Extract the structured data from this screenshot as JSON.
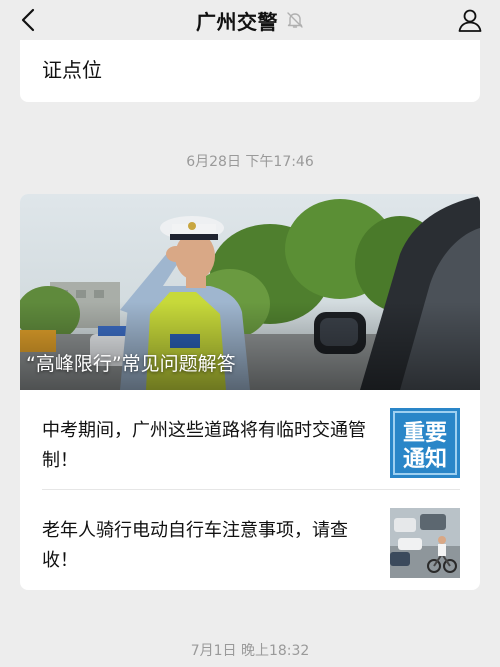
{
  "navbar": {
    "title": "广州交警",
    "back_icon": "back-chevron-icon",
    "mute_icon": "bell-muted-icon",
    "profile_icon": "person-icon"
  },
  "previous_card": {
    "text": "证点位"
  },
  "messages": [
    {
      "timestamp": "6月28日 下午17:46",
      "cover": {
        "title": "“高峰限行”常见问题解答"
      },
      "items": [
        {
          "title": "中考期间，广州这些道路将有临时交通管制！",
          "thumb_text_line1": "重要",
          "thumb_text_line2": "通知"
        },
        {
          "title": "老年人骑行电动自行车注意事项，请查收！"
        }
      ]
    },
    {
      "timestamp": "7月1日 晚上18:32"
    }
  ],
  "colors": {
    "background": "#ededed",
    "card": "#ffffff",
    "timestamp": "#9a9a9a",
    "notice_blue": "#2a86c8"
  }
}
